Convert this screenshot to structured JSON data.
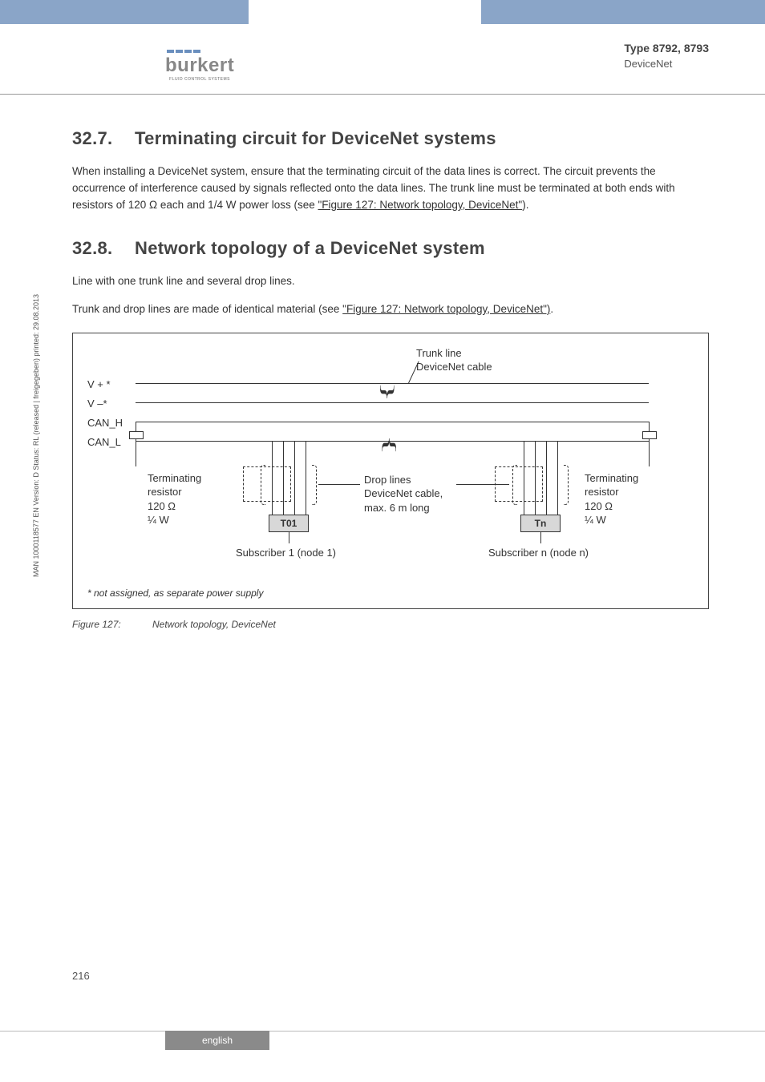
{
  "header": {
    "logo_text": "burkert",
    "logo_sub": "FLUID CONTROL SYSTEMS",
    "type": "Type 8792, 8793",
    "subtitle": "DeviceNet"
  },
  "sections": {
    "s1": {
      "num": "32.7.",
      "title": "Terminating circuit for DeviceNet systems",
      "p1a": "When installing a DeviceNet system, ensure that the terminating circuit of the data lines is correct. The circuit prevents the occurrence of interference caused by signals reflected onto the data lines. The trunk line must be terminated at both ends with resistors of 120 Ω each and 1/4 W power loss (see ",
      "p1_link": "\"Figure 127: Network topology, DeviceNet\"",
      "p1b": ")."
    },
    "s2": {
      "num": "32.8.",
      "title": "Network topology of a DeviceNet system",
      "p1": "Line with one trunk line and several drop lines.",
      "p2a": "Trunk and drop lines are made of identical material (see ",
      "p2_link": "\"Figure 127: Network topology, DeviceNet\")",
      "p2b": "."
    }
  },
  "figure": {
    "lines": {
      "l1": "V + *",
      "l2": "V –*",
      "l3": "CAN_H",
      "l4": "CAN_L"
    },
    "trunk_label_1": "Trunk line",
    "trunk_label_2": "DeviceNet cable",
    "drop_label_1": "Drop lines",
    "drop_label_2": "DeviceNet cable,",
    "drop_label_3": "max. 6 m long",
    "term_l1": "Terminating",
    "term_l2": "resistor",
    "term_l3": "120 Ω",
    "term_l4": "¼ W",
    "node1": "T01",
    "noden": "Tn",
    "sub1": "Subscriber 1 (node 1)",
    "subn": "Subscriber n (node n)",
    "footnote": "*  not assigned, as separate power supply",
    "fignum": "Figure 127:",
    "figtext": "Network topology, DeviceNet"
  },
  "meta": {
    "side": "MAN 1000118577 EN Version: D Status: RL (released | freigegeben) printed: 29.08.2013",
    "page": "216",
    "footer": "english"
  }
}
